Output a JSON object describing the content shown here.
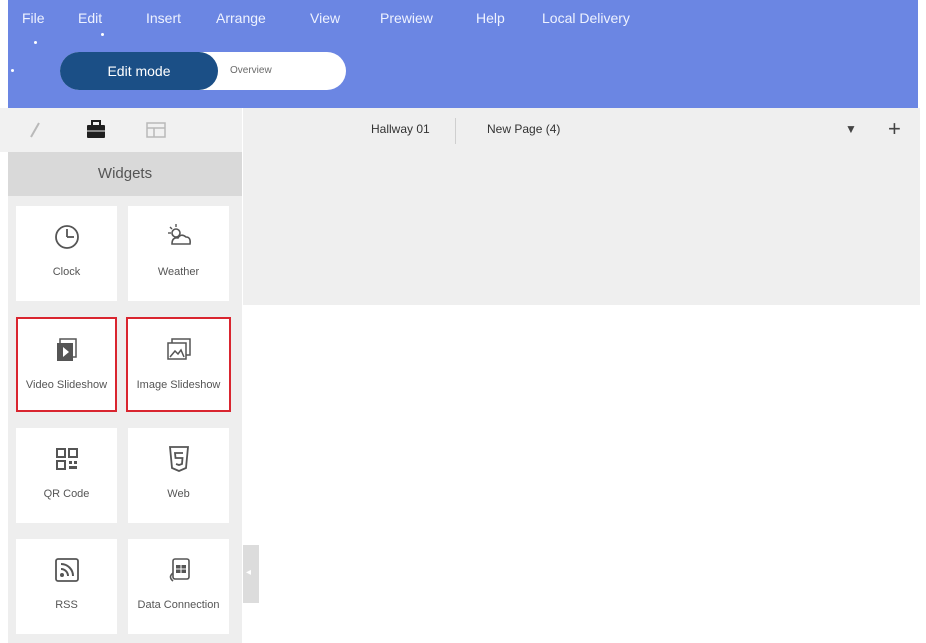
{
  "menu": {
    "items": [
      "File",
      "Edit",
      "Insert",
      "Arrange",
      "View",
      "Prewiew",
      "Help",
      "Local Delivery"
    ]
  },
  "mode": {
    "active_label": "Edit mode",
    "inactive_label": "Overview"
  },
  "sidebar": {
    "tabs": [
      "pencil-icon",
      "briefcase-icon",
      "layout-icon"
    ],
    "heading": "Widgets",
    "widgets": [
      {
        "label": "Clock",
        "icon": "clock-icon"
      },
      {
        "label": "Weather",
        "icon": "weather-icon"
      },
      {
        "label": "Video Slideshow",
        "icon": "video-slideshow-icon"
      },
      {
        "label": "Image Slideshow",
        "icon": "image-slideshow-icon"
      },
      {
        "label": "QR Code",
        "icon": "qr-code-icon"
      },
      {
        "label": "Web",
        "icon": "html5-icon"
      },
      {
        "label": "RSS",
        "icon": "rss-icon"
      },
      {
        "label": "Data Connection",
        "icon": "data-connection-icon"
      }
    ]
  },
  "pages": {
    "tabs": [
      "Hallway 01",
      "New Page (4)"
    ],
    "dropdown_icon": "chevron-down-icon",
    "add_icon": "plus-icon"
  },
  "colors": {
    "topbar": "#6b86e3",
    "mode_active": "#1b4f86",
    "highlight": "#d9252f"
  }
}
